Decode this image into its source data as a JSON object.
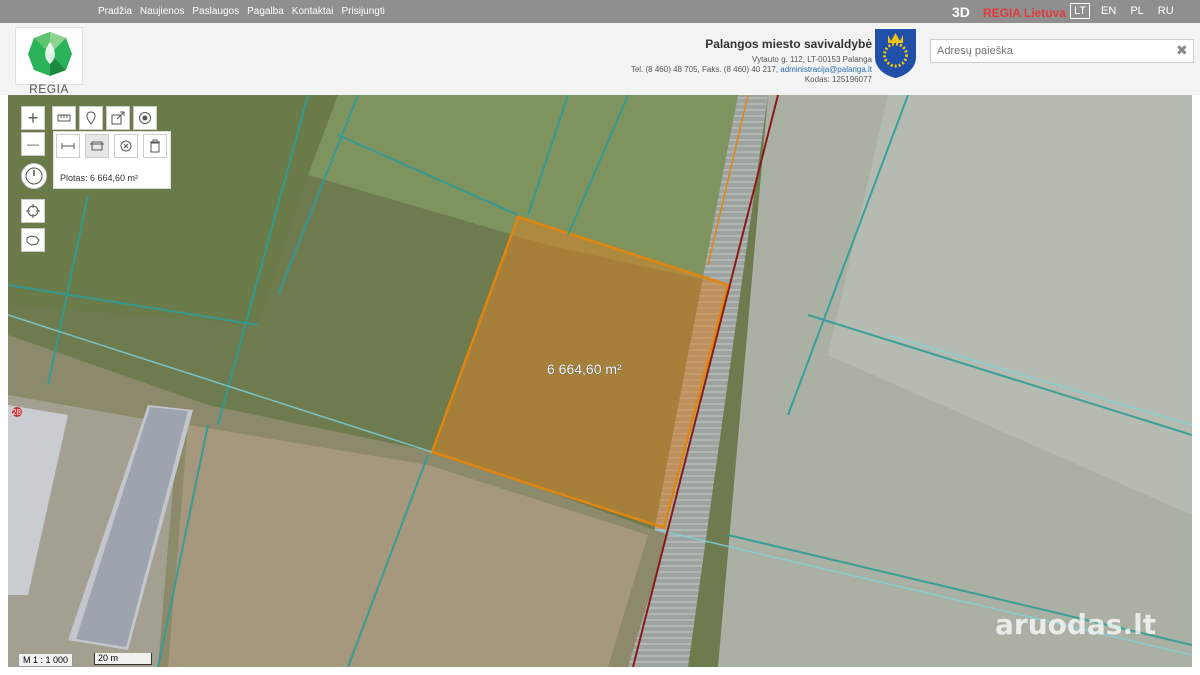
{
  "topbar": {
    "nav": [
      "Pradžia",
      "Naujienos",
      "Paslaugos",
      "Pagalba",
      "Kontaktai",
      "Prisijungti"
    ],
    "btn_3d": "3D",
    "regia_lietuva": "REGIA Lietuva",
    "langs": [
      "LT",
      "EN",
      "PL",
      "RU"
    ],
    "active_lang": "LT"
  },
  "header": {
    "logo_text": "REGIA",
    "municipality": "Palangos miesto savivaldybė",
    "address": "Vytauto g. 112, LT-00153 Palanga",
    "phone": "Tel. (8 460) 48 705, Faks. (8 460) 40 217, ",
    "email": "administracija@palanga.lt",
    "code": "Kodas: 125196077",
    "search_placeholder": "Adresų paieška",
    "search_clear": "✖"
  },
  "map": {
    "area_panel_label": "Plotas: 6 664,60 m²",
    "area_on_map": "6 664,60 m²",
    "scale": "M 1 : 1 000",
    "scalebar": "20 m",
    "watermark": "aruodas.lt",
    "marker": "28",
    "zoom_in": "+",
    "zoom_out": "—"
  },
  "icons": [
    "ruler-icon",
    "pin-icon",
    "export-icon",
    "target-icon",
    "distance-icon",
    "area-icon",
    "clear-icon",
    "trash-icon",
    "compass-icon",
    "locate-icon",
    "lithuania-icon"
  ]
}
